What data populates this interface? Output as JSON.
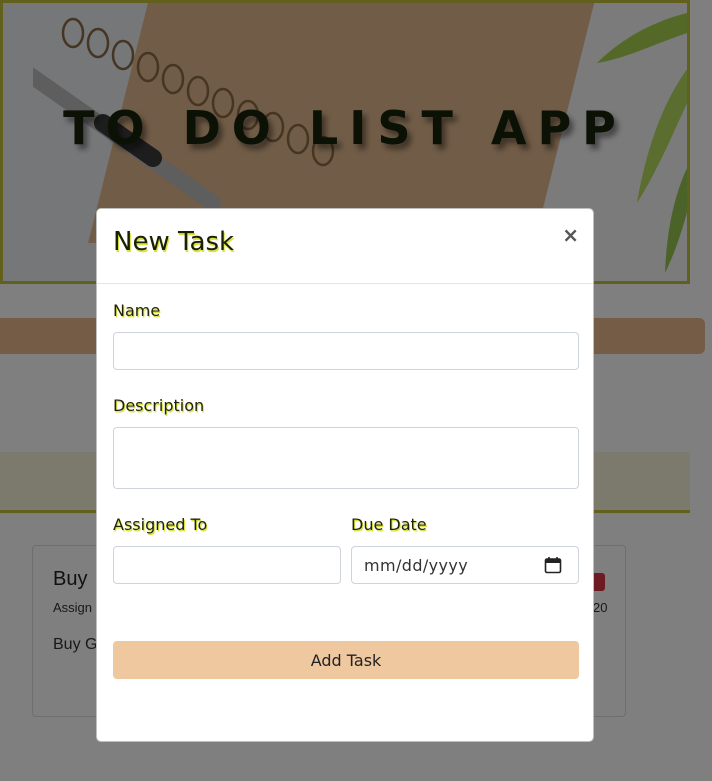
{
  "app": {
    "title": "TO DO LIST APP"
  },
  "task_card": {
    "title": "Buy",
    "meta": "Assign",
    "desc": "Buy G",
    "badge": "",
    "date": "20"
  },
  "modal": {
    "title": "New Task",
    "close_symbol": "×",
    "fields": {
      "name": {
        "label": "Name",
        "value": ""
      },
      "description": {
        "label": "Description",
        "value": ""
      },
      "assigned_to": {
        "label": "Assigned To",
        "value": ""
      },
      "due_date": {
        "label": "Due Date",
        "display": "mm/dd/yyyy"
      }
    },
    "submit_label": "Add Task"
  },
  "colors": {
    "accent_yellow": "#c2c23a",
    "button_peach": "#efc8a0",
    "badge_red": "#dc3545"
  },
  "icons": {
    "calendar": "calendar-icon",
    "close": "close-icon"
  }
}
